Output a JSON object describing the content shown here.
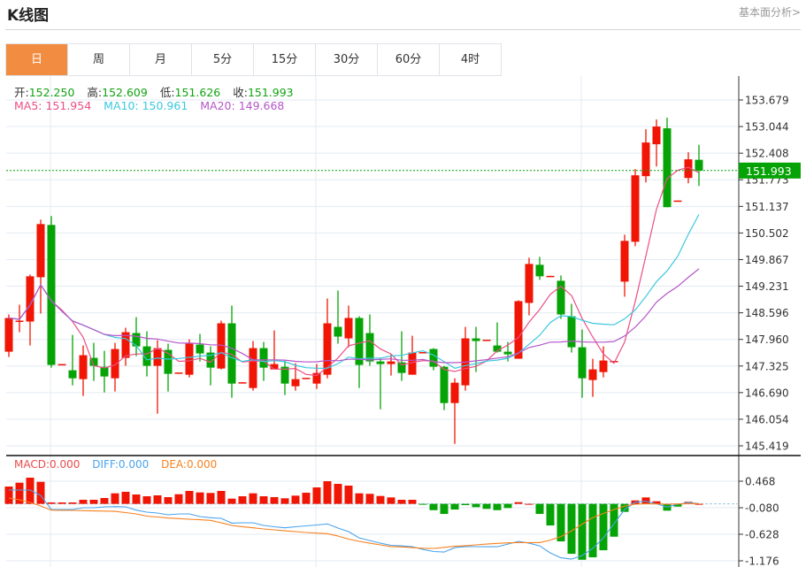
{
  "header": {
    "title": "K线图",
    "link": "基本面分析>"
  },
  "tabs": [
    {
      "label": "日",
      "active": true
    },
    {
      "label": "周"
    },
    {
      "label": "月"
    },
    {
      "label": "5分"
    },
    {
      "label": "15分"
    },
    {
      "label": "30分"
    },
    {
      "label": "60分"
    },
    {
      "label": "4时"
    }
  ],
  "ohlc_legend": {
    "open_label": "开:",
    "open": "152.250",
    "high_label": "高:",
    "high": "152.609",
    "low_label": "低:",
    "low": "151.626",
    "close_label": "收:",
    "close": "151.993"
  },
  "ma_legend": {
    "ma5": "MA5: 151.954",
    "ma10": "MA10: 150.961",
    "ma20": "MA20: 149.668"
  },
  "macd_legend": {
    "macd": "MACD:0.000",
    "diff": "DIFF:0.000",
    "dea": "DEA:0.000"
  },
  "current_price": "151.993",
  "colors": {
    "up": "#f01505",
    "down": "#06a306",
    "ma5": "#ea4f86",
    "ma10": "#3cc8df",
    "ma20": "#b556c9",
    "diff": "#4aa3ec",
    "dea": "#f7801e",
    "active_tab": "#f28c40",
    "price_tag": "#06a306"
  },
  "chart_data": [
    {
      "type": "candlestick",
      "y_ticks": [
        "153.679",
        "153.044",
        "152.408",
        "151.773",
        "151.137",
        "150.502",
        "149.867",
        "149.231",
        "148.596",
        "147.960",
        "147.325",
        "146.690",
        "146.054",
        "145.419"
      ],
      "ylim": [
        145.419,
        153.679
      ],
      "grid": true,
      "ma_periods": [
        5,
        10,
        20
      ],
      "candles": [
        [
          147.667,
          148.556,
          147.54,
          148.472
        ],
        [
          148.408,
          148.789,
          148.133,
          148.408
        ],
        [
          148.387,
          149.509,
          147.815,
          149.467
        ],
        [
          149.445,
          150.821,
          148.578,
          150.715
        ],
        [
          150.694,
          150.906,
          147.286,
          147.35
        ],
        [
          147.35,
          147.371,
          147.35,
          147.371
        ],
        [
          147.223,
          148.069,
          146.863,
          147.032
        ],
        [
          147.011,
          147.815,
          146.609,
          147.583
        ],
        [
          147.519,
          147.879,
          146.969,
          147.329
        ],
        [
          147.307,
          147.688,
          146.694,
          147.075
        ],
        [
          147.032,
          147.879,
          146.715,
          147.731
        ],
        [
          147.519,
          148.239,
          147.329,
          148.133
        ],
        [
          148.112,
          148.493,
          147.561,
          147.794
        ],
        [
          147.794,
          148.154,
          147.075,
          147.329
        ],
        [
          147.329,
          147.942,
          146.186,
          147.752
        ],
        [
          147.71,
          147.858,
          146.715,
          147.138
        ],
        [
          147.159,
          147.17,
          147.159,
          147.17
        ],
        [
          147.117,
          147.964,
          147.053,
          147.858
        ],
        [
          147.837,
          148.091,
          147.434,
          147.625
        ],
        [
          147.646,
          147.794,
          146.863,
          147.286
        ],
        [
          147.265,
          148.408,
          147.244,
          148.345
        ],
        [
          148.345,
          148.768,
          146.567,
          146.905
        ],
        [
          146.926,
          146.937,
          146.926,
          146.937
        ],
        [
          146.799,
          147.921,
          146.736,
          147.752
        ],
        [
          147.752,
          147.9,
          146.969,
          147.286
        ],
        [
          147.244,
          148.175,
          147.244,
          147.371
        ],
        [
          147.307,
          147.456,
          146.63,
          146.905
        ],
        [
          146.842,
          147.392,
          146.736,
          147.011
        ],
        [
          147.032,
          147.043,
          147.032,
          147.043
        ],
        [
          146.905,
          147.371,
          146.778,
          147.159
        ],
        [
          147.117,
          148.937,
          147.032,
          148.345
        ],
        [
          148.26,
          149.128,
          147.858,
          148.027
        ],
        [
          147.985,
          148.768,
          147.773,
          148.472
        ],
        [
          148.472,
          148.514,
          146.799,
          147.35
        ],
        [
          148.112,
          148.556,
          147.329,
          147.434
        ],
        [
          147.434,
          147.498,
          146.291,
          147.371
        ],
        [
          147.371,
          147.604,
          147.096,
          147.434
        ],
        [
          147.413,
          148.154,
          146.969,
          147.159
        ],
        [
          147.117,
          148.048,
          147.117,
          147.646
        ],
        [
          147.646,
          147.657,
          147.646,
          147.657
        ],
        [
          147.731,
          147.752,
          147.223,
          147.307
        ],
        [
          147.307,
          147.329,
          146.27,
          146.44
        ],
        [
          146.44,
          147.032,
          145.466,
          146.926
        ],
        [
          146.863,
          148.26,
          146.736,
          147.985
        ],
        [
          147.985,
          148.26,
          147.18,
          147.921
        ],
        [
          147.942,
          147.953,
          147.942,
          147.953
        ],
        [
          147.815,
          148.366,
          147.646,
          147.667
        ],
        [
          147.667,
          147.9,
          147.434,
          147.604
        ],
        [
          147.498,
          148.895,
          147.498,
          148.874
        ],
        [
          148.832,
          149.911,
          148.535,
          149.763
        ],
        [
          149.742,
          149.932,
          149.382,
          149.467
        ],
        [
          149.467,
          149.478,
          149.467,
          149.478
        ],
        [
          149.361,
          149.488,
          148.451,
          148.556
        ],
        [
          148.514,
          148.81,
          147.646,
          147.773
        ],
        [
          147.773,
          148.197,
          146.567,
          147.032
        ],
        [
          146.99,
          147.498,
          146.588,
          147.244
        ],
        [
          147.18,
          147.794,
          147.053,
          147.456
        ],
        [
          147.434,
          147.445,
          147.434,
          147.445
        ],
        [
          149.34,
          150.461,
          148.98,
          150.313
        ],
        [
          150.292,
          152.028,
          150.186,
          151.88
        ],
        [
          151.859,
          152.98,
          151.71,
          152.663
        ],
        [
          152.621,
          153.213,
          152.091,
          153.044
        ],
        [
          153.002,
          153.256,
          151.118,
          151.118
        ],
        [
          151.266,
          151.277,
          151.266,
          151.277
        ],
        [
          151.816,
          152.43,
          151.689,
          152.261
        ],
        [
          152.25,
          152.609,
          151.626,
          151.993
        ]
      ]
    },
    {
      "type": "bar+line",
      "y_ticks": [
        "0.468",
        "-0.080",
        "-0.628",
        "-1.176"
      ],
      "ylim": [
        -1.176,
        0.468
      ],
      "macd": [
        0.358,
        0.437,
        0.541,
        0.455,
        0.03,
        0.03,
        0.03,
        0.084,
        0.084,
        0.121,
        0.218,
        0.249,
        0.194,
        0.157,
        0.176,
        0.139,
        0.199,
        0.267,
        0.236,
        0.225,
        0.267,
        0.108,
        0.157,
        0.218,
        0.157,
        0.139,
        0.115,
        0.17,
        0.23,
        0.34,
        0.468,
        0.413,
        0.377,
        0.218,
        0.207,
        0.163,
        0.133,
        0.084,
        0.084,
        -0.007,
        -0.13,
        -0.208,
        -0.117,
        -0.026,
        -0.068,
        -0.104,
        -0.13,
        -0.086,
        0.035,
        0,
        -0.208,
        -0.446,
        -0.775,
        -1.031,
        -1.154,
        -1.104,
        -0.958,
        -0.678,
        -0.166,
        0.071,
        0.133,
        0.053,
        -0.141,
        -0.057,
        0.042,
        0
      ],
      "diff": [
        0.285,
        0.285,
        0.285,
        0.176,
        -0.117,
        -0.117,
        -0.117,
        -0.08,
        -0.08,
        -0.062,
        -0.057,
        -0.062,
        -0.13,
        -0.172,
        -0.19,
        -0.227,
        -0.208,
        -0.208,
        -0.263,
        -0.287,
        -0.3,
        -0.397,
        -0.391,
        -0.391,
        -0.446,
        -0.473,
        -0.495,
        -0.473,
        -0.455,
        -0.437,
        -0.415,
        -0.501,
        -0.574,
        -0.702,
        -0.757,
        -0.812,
        -0.857,
        -0.867,
        -0.885,
        -0.94,
        -0.985,
        -0.995,
        -0.903,
        -0.881,
        -0.883,
        -0.885,
        -0.885,
        -0.83,
        -0.775,
        -0.812,
        -0.867,
        -1.013,
        -1.113,
        -1.141,
        -1.068,
        -0.921,
        -0.702,
        -0.41,
        -0.117,
        0.035,
        0.053,
        0.002,
        -0.068,
        -0.007,
        0.024,
        0.005
      ],
      "dea": [
        0.121,
        0.084,
        0.029,
        -0.044,
        -0.13,
        -0.135,
        -0.135,
        -0.141,
        -0.146,
        -0.15,
        -0.154,
        -0.181,
        -0.208,
        -0.254,
        -0.272,
        -0.291,
        -0.305,
        -0.318,
        -0.329,
        -0.342,
        -0.391,
        -0.446,
        -0.47,
        -0.494,
        -0.519,
        -0.537,
        -0.556,
        -0.574,
        -0.592,
        -0.605,
        -0.616,
        -0.665,
        -0.729,
        -0.775,
        -0.812,
        -0.848,
        -0.881,
        -0.89,
        -0.903,
        -0.916,
        -0.921,
        -0.898,
        -0.876,
        -0.863,
        -0.848,
        -0.83,
        -0.817,
        -0.806,
        -0.799,
        -0.799,
        -0.799,
        -0.748,
        -0.675,
        -0.556,
        -0.419,
        -0.282,
        -0.199,
        -0.117,
        -0.048,
        -0.007,
        0.002,
        -0.002,
        -0.007,
        -0.002,
        0.004,
        0.005
      ]
    }
  ]
}
